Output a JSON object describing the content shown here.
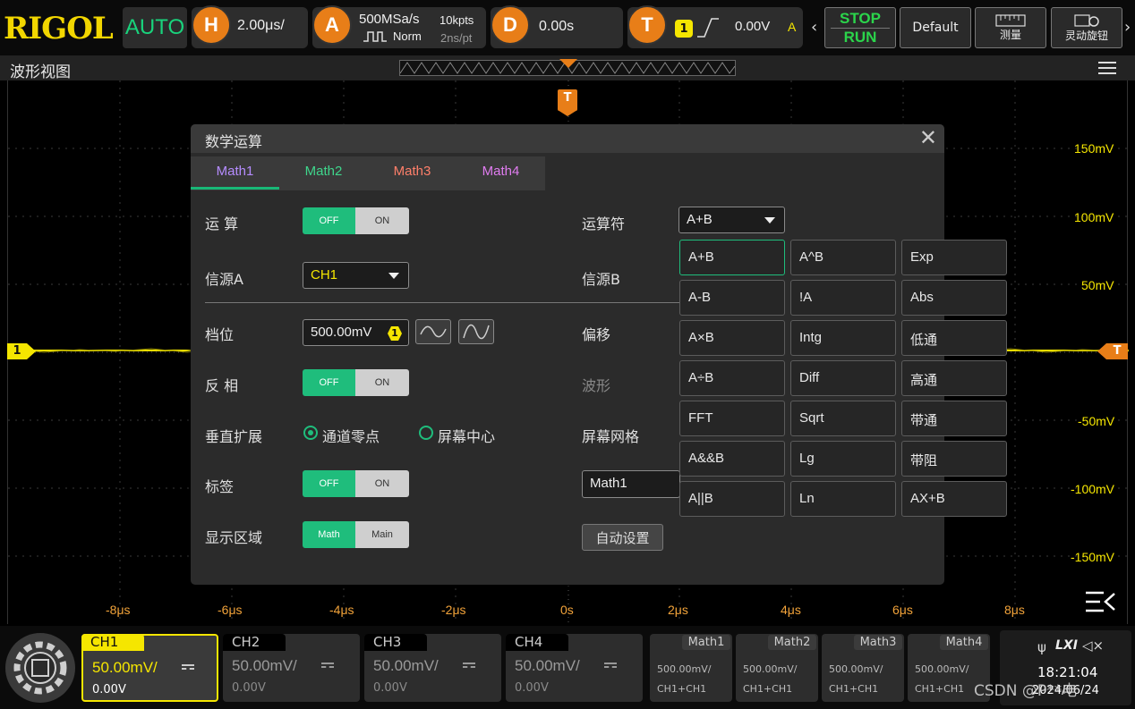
{
  "top_bar": {
    "logo": "RIGOL",
    "auto_label": "AUTO",
    "horizontal": {
      "badge": "H",
      "value": "2.00μs/"
    },
    "acquire": {
      "badge": "A",
      "sample_rate": "500MSa/s",
      "mode": "Norm",
      "memory_depth": "10kpts",
      "sample_interval": "2ns/pt"
    },
    "delay": {
      "badge": "D",
      "value": "0.00s"
    },
    "trigger": {
      "badge": "T",
      "source": "1",
      "level": "0.00V",
      "state": "A"
    },
    "stop_label": "STOP",
    "run_label": "RUN",
    "default_label": "Default",
    "measure_label": "测量",
    "quick_knob_label": "灵动旋钮"
  },
  "waveform": {
    "title": "波形视图",
    "trigger_marker": "T",
    "channel_marker": "1",
    "level_marker": "T",
    "y_labels": [
      "150mV",
      "100mV",
      "50mV",
      "-50mV",
      "-100mV",
      "-150mV"
    ],
    "x_labels": [
      "-8μs",
      "-6μs",
      "-4μs",
      "-2μs",
      "0s",
      "2μs",
      "4μs",
      "6μs",
      "8μs"
    ]
  },
  "dialog": {
    "title": "数学运算",
    "tabs": [
      {
        "label": "Math1",
        "color": "#b58cff"
      },
      {
        "label": "Math2",
        "color": "#3fd68c"
      },
      {
        "label": "Math3",
        "color": "#ff7f6a"
      },
      {
        "label": "Math4",
        "color": "#e07cf0"
      }
    ],
    "operation": {
      "label": "运 算",
      "off": "OFF",
      "on": "ON"
    },
    "source_a": {
      "label": "信源A",
      "value": "CH1"
    },
    "scale": {
      "label": "档位",
      "value": "500.00mV",
      "badge": "1"
    },
    "invert": {
      "label": "反 相",
      "off": "OFF",
      "on": "ON"
    },
    "vertical_expand": {
      "label": "垂直扩展",
      "option1": "通道零点",
      "option2": "屏幕中心"
    },
    "tag": {
      "label": "标签",
      "off": "OFF",
      "on": "ON"
    },
    "display_area": {
      "label": "显示区域",
      "opt1": "Math",
      "opt2": "Main"
    },
    "operator": {
      "label": "运算符",
      "value": "A+B"
    },
    "source_b": {
      "label": "信源B"
    },
    "offset": {
      "label": "偏移"
    },
    "waveform_lbl": {
      "label": "波形"
    },
    "screen_grid": {
      "label": "屏幕网格"
    },
    "label_input": "Math1",
    "auto_setup": "自动设置",
    "operators": [
      "A+B",
      "A^B",
      "Exp",
      "A-B",
      "!A",
      "Abs",
      "A×B",
      "Intg",
      "低通",
      "A÷B",
      "Diff",
      "高通",
      "FFT",
      "Sqrt",
      "带通",
      "A&&B",
      "Lg",
      "带阻",
      "A||B",
      "Ln",
      "AX+B"
    ]
  },
  "bottom_bar": {
    "channels": [
      {
        "name": "CH1",
        "scale": "50.00mV/",
        "offset": "0.00V",
        "active": true
      },
      {
        "name": "CH2",
        "scale": "50.00mV/",
        "offset": "0.00V",
        "active": false
      },
      {
        "name": "CH3",
        "scale": "50.00mV/",
        "offset": "0.00V",
        "active": false
      },
      {
        "name": "CH4",
        "scale": "50.00mV/",
        "offset": "0.00V",
        "active": false
      }
    ],
    "maths": [
      {
        "name": "Math1",
        "scale": "500.00mV/",
        "source": "CH1+CH1"
      },
      {
        "name": "Math2",
        "scale": "500.00mV/",
        "source": "CH1+CH1"
      },
      {
        "name": "Math3",
        "scale": "500.00mV/",
        "source": "CH1+CH1"
      },
      {
        "name": "Math4",
        "scale": "500.00mV/",
        "source": "CH1+CH1"
      }
    ],
    "lxi_label": "LXI",
    "time": "18:21:04",
    "date": "2024/06/24",
    "watermark": "CSDN @P**电"
  },
  "colors": {
    "accent": "#1fbd7c",
    "ch1": "#f5e600",
    "orange": "#e87e18"
  }
}
